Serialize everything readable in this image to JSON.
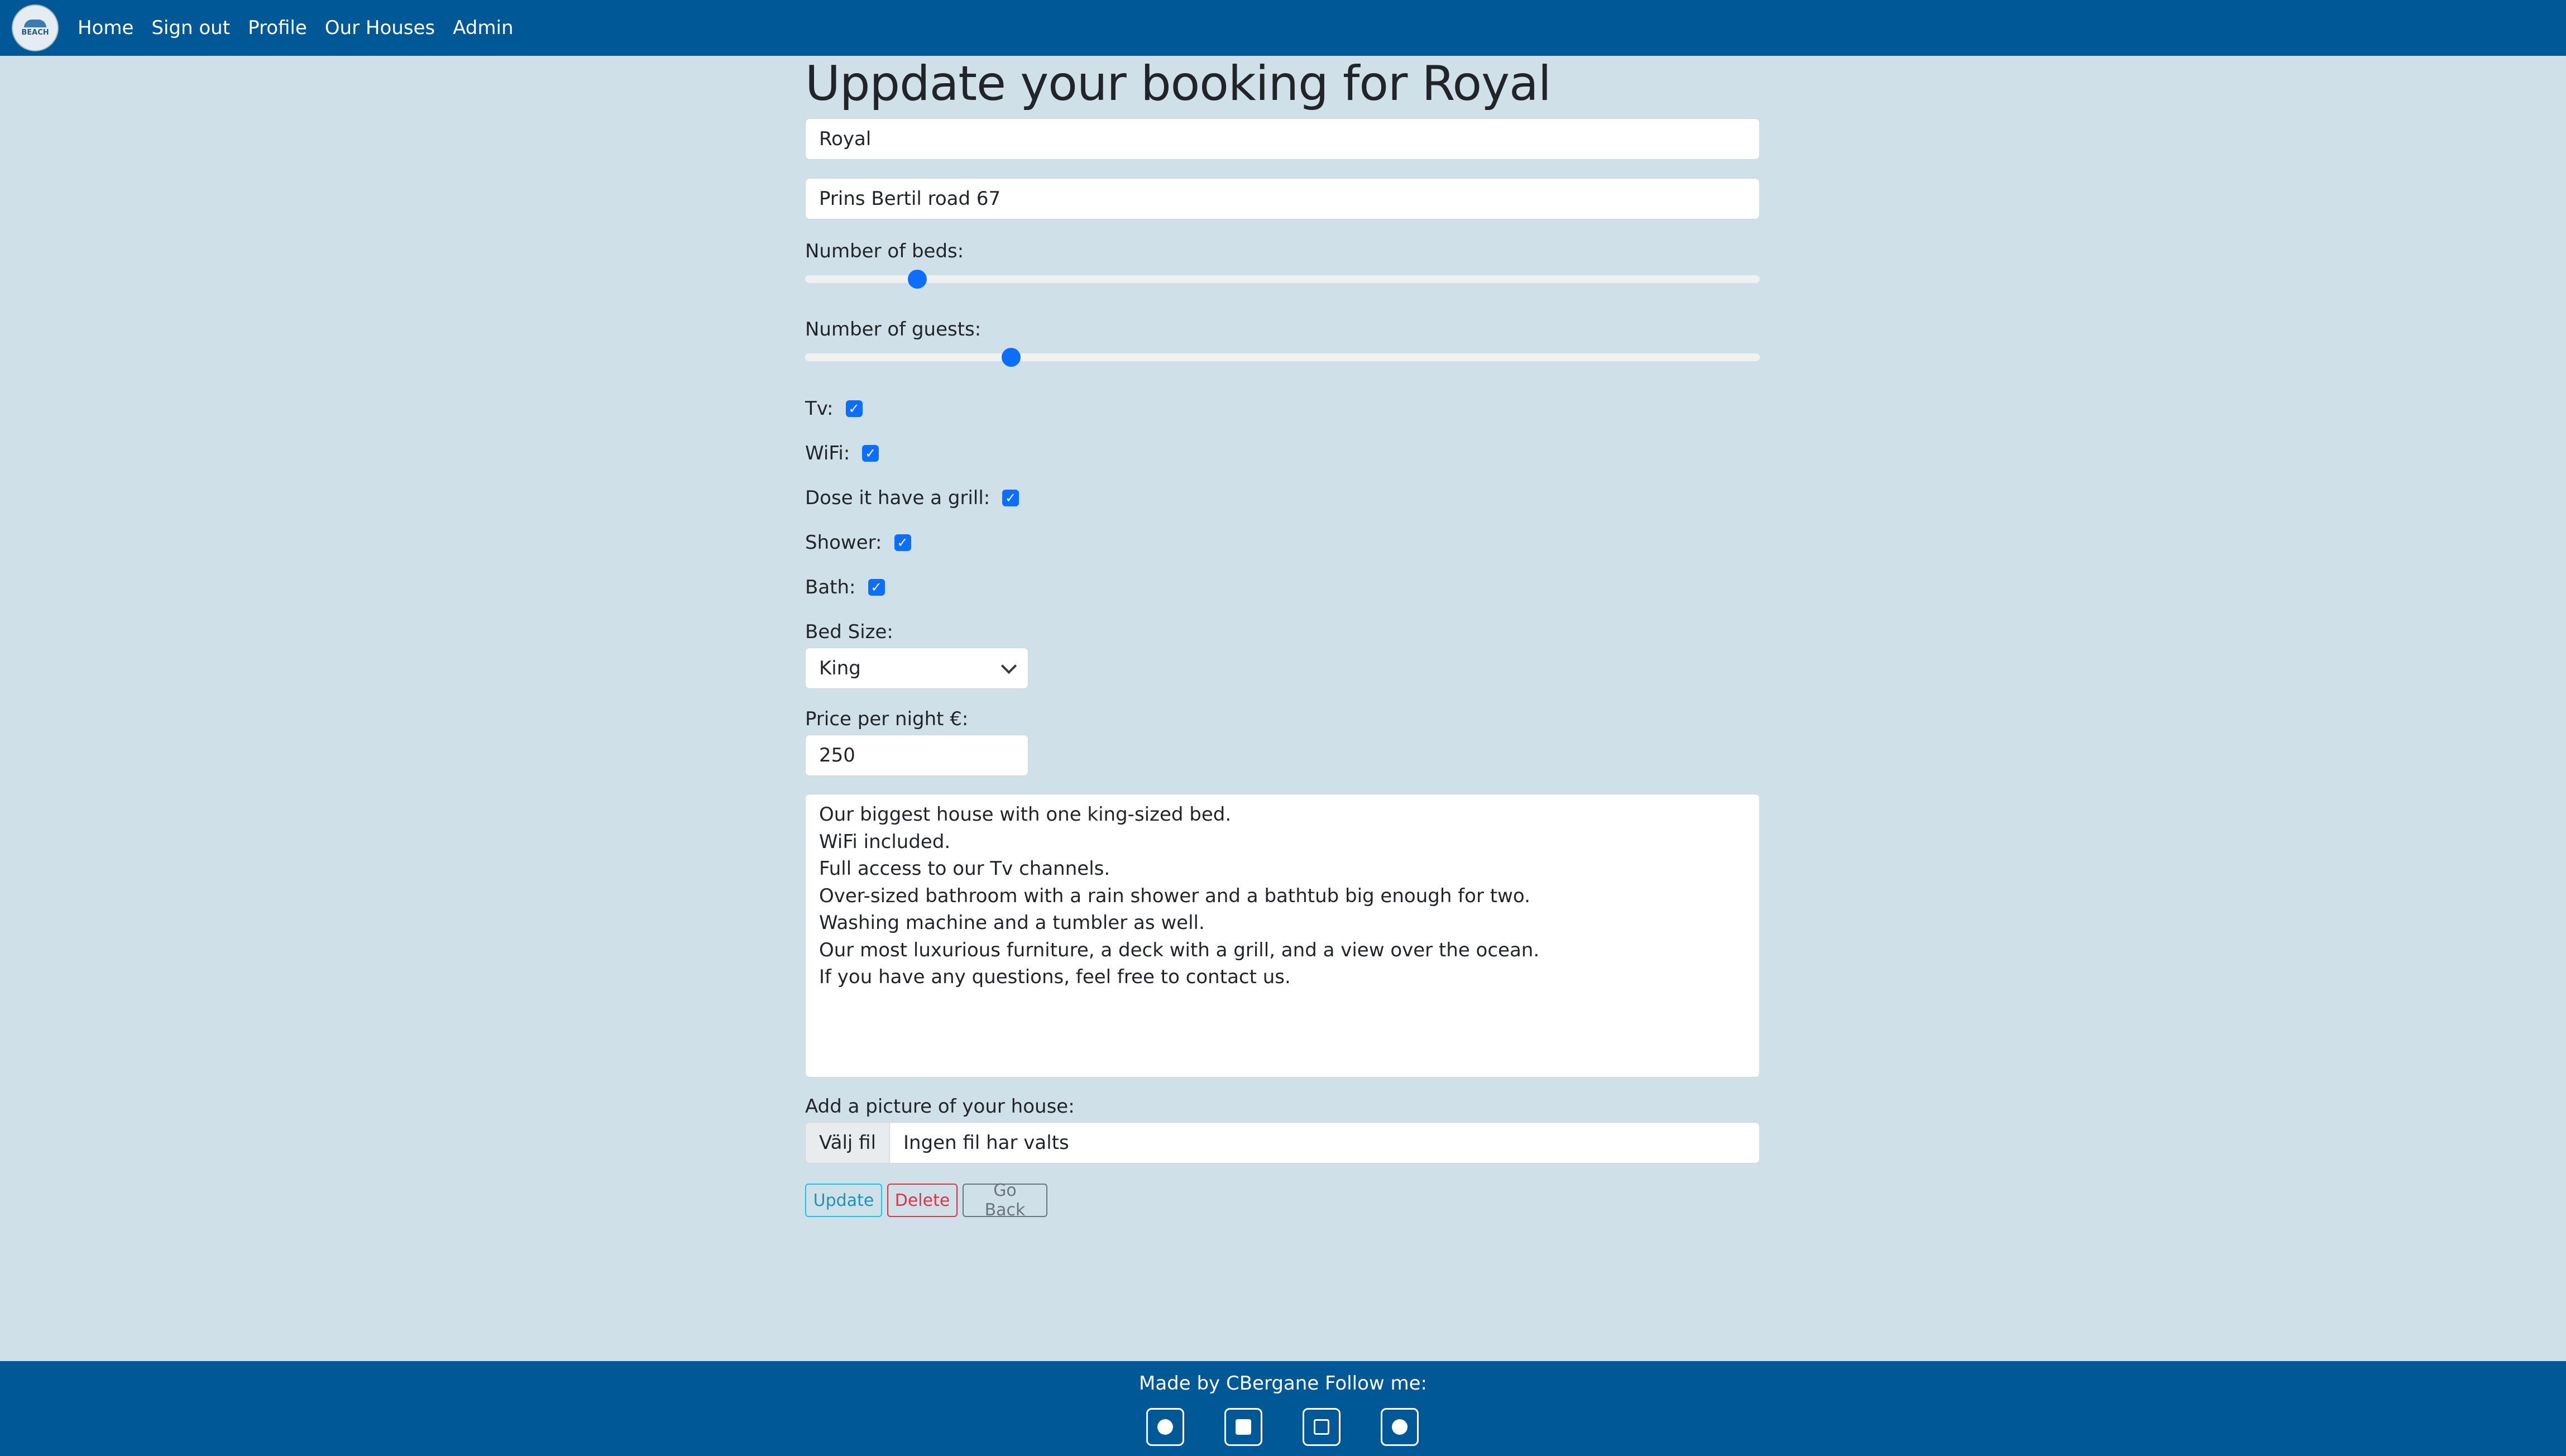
{
  "nav": {
    "logo_text": "BEACH",
    "links": [
      "Home",
      "Sign out",
      "Profile",
      "Our Houses",
      "Admin"
    ]
  },
  "page": {
    "title": "Uppdate your booking for Royal"
  },
  "form": {
    "name_value": "Royal",
    "address_value": "Prins Bertil road 67",
    "beds_label": "Number of beds:",
    "beds_level": 0.11,
    "guests_label": "Number of guests:",
    "guests_level": 0.21,
    "checkboxes": [
      {
        "label": "Tv:",
        "checked": true
      },
      {
        "label": "WiFi:",
        "checked": true
      },
      {
        "label": "Dose it have a grill:",
        "checked": true
      },
      {
        "label": "Shower:",
        "checked": true
      },
      {
        "label": "Bath:",
        "checked": true
      }
    ],
    "bed_size_label": "Bed Size:",
    "bed_size_value": "King",
    "price_label": "Price per night €:",
    "price_value": "250",
    "description_lines": [
      "Our biggest house with one king-sized bed.",
      "WiFi included.",
      "Full access to our Tv channels.",
      "Over-sized bathroom with a rain shower and a bathtub big enough for two.",
      "Washing machine and a tumbler as well.",
      "Our most luxurious furniture, a deck with a grill, and a view over the ocean.",
      "If you have any questions, feel free to contact us."
    ],
    "picture_label": "Add a picture of your house:",
    "file_button": "Välj fil",
    "file_status": "Ingen fil har valts"
  },
  "buttons": {
    "update": "Update",
    "delete": "Delete",
    "back": "Go Back"
  },
  "footer": {
    "text": "Made by CBergane Follow me:",
    "icons": [
      "facebook-icon",
      "linkedin-icon",
      "instagram-icon",
      "github-icon"
    ]
  },
  "colors": {
    "navbar": "#005896",
    "background": "#cfe0e9",
    "accent": "#0d6efd"
  }
}
